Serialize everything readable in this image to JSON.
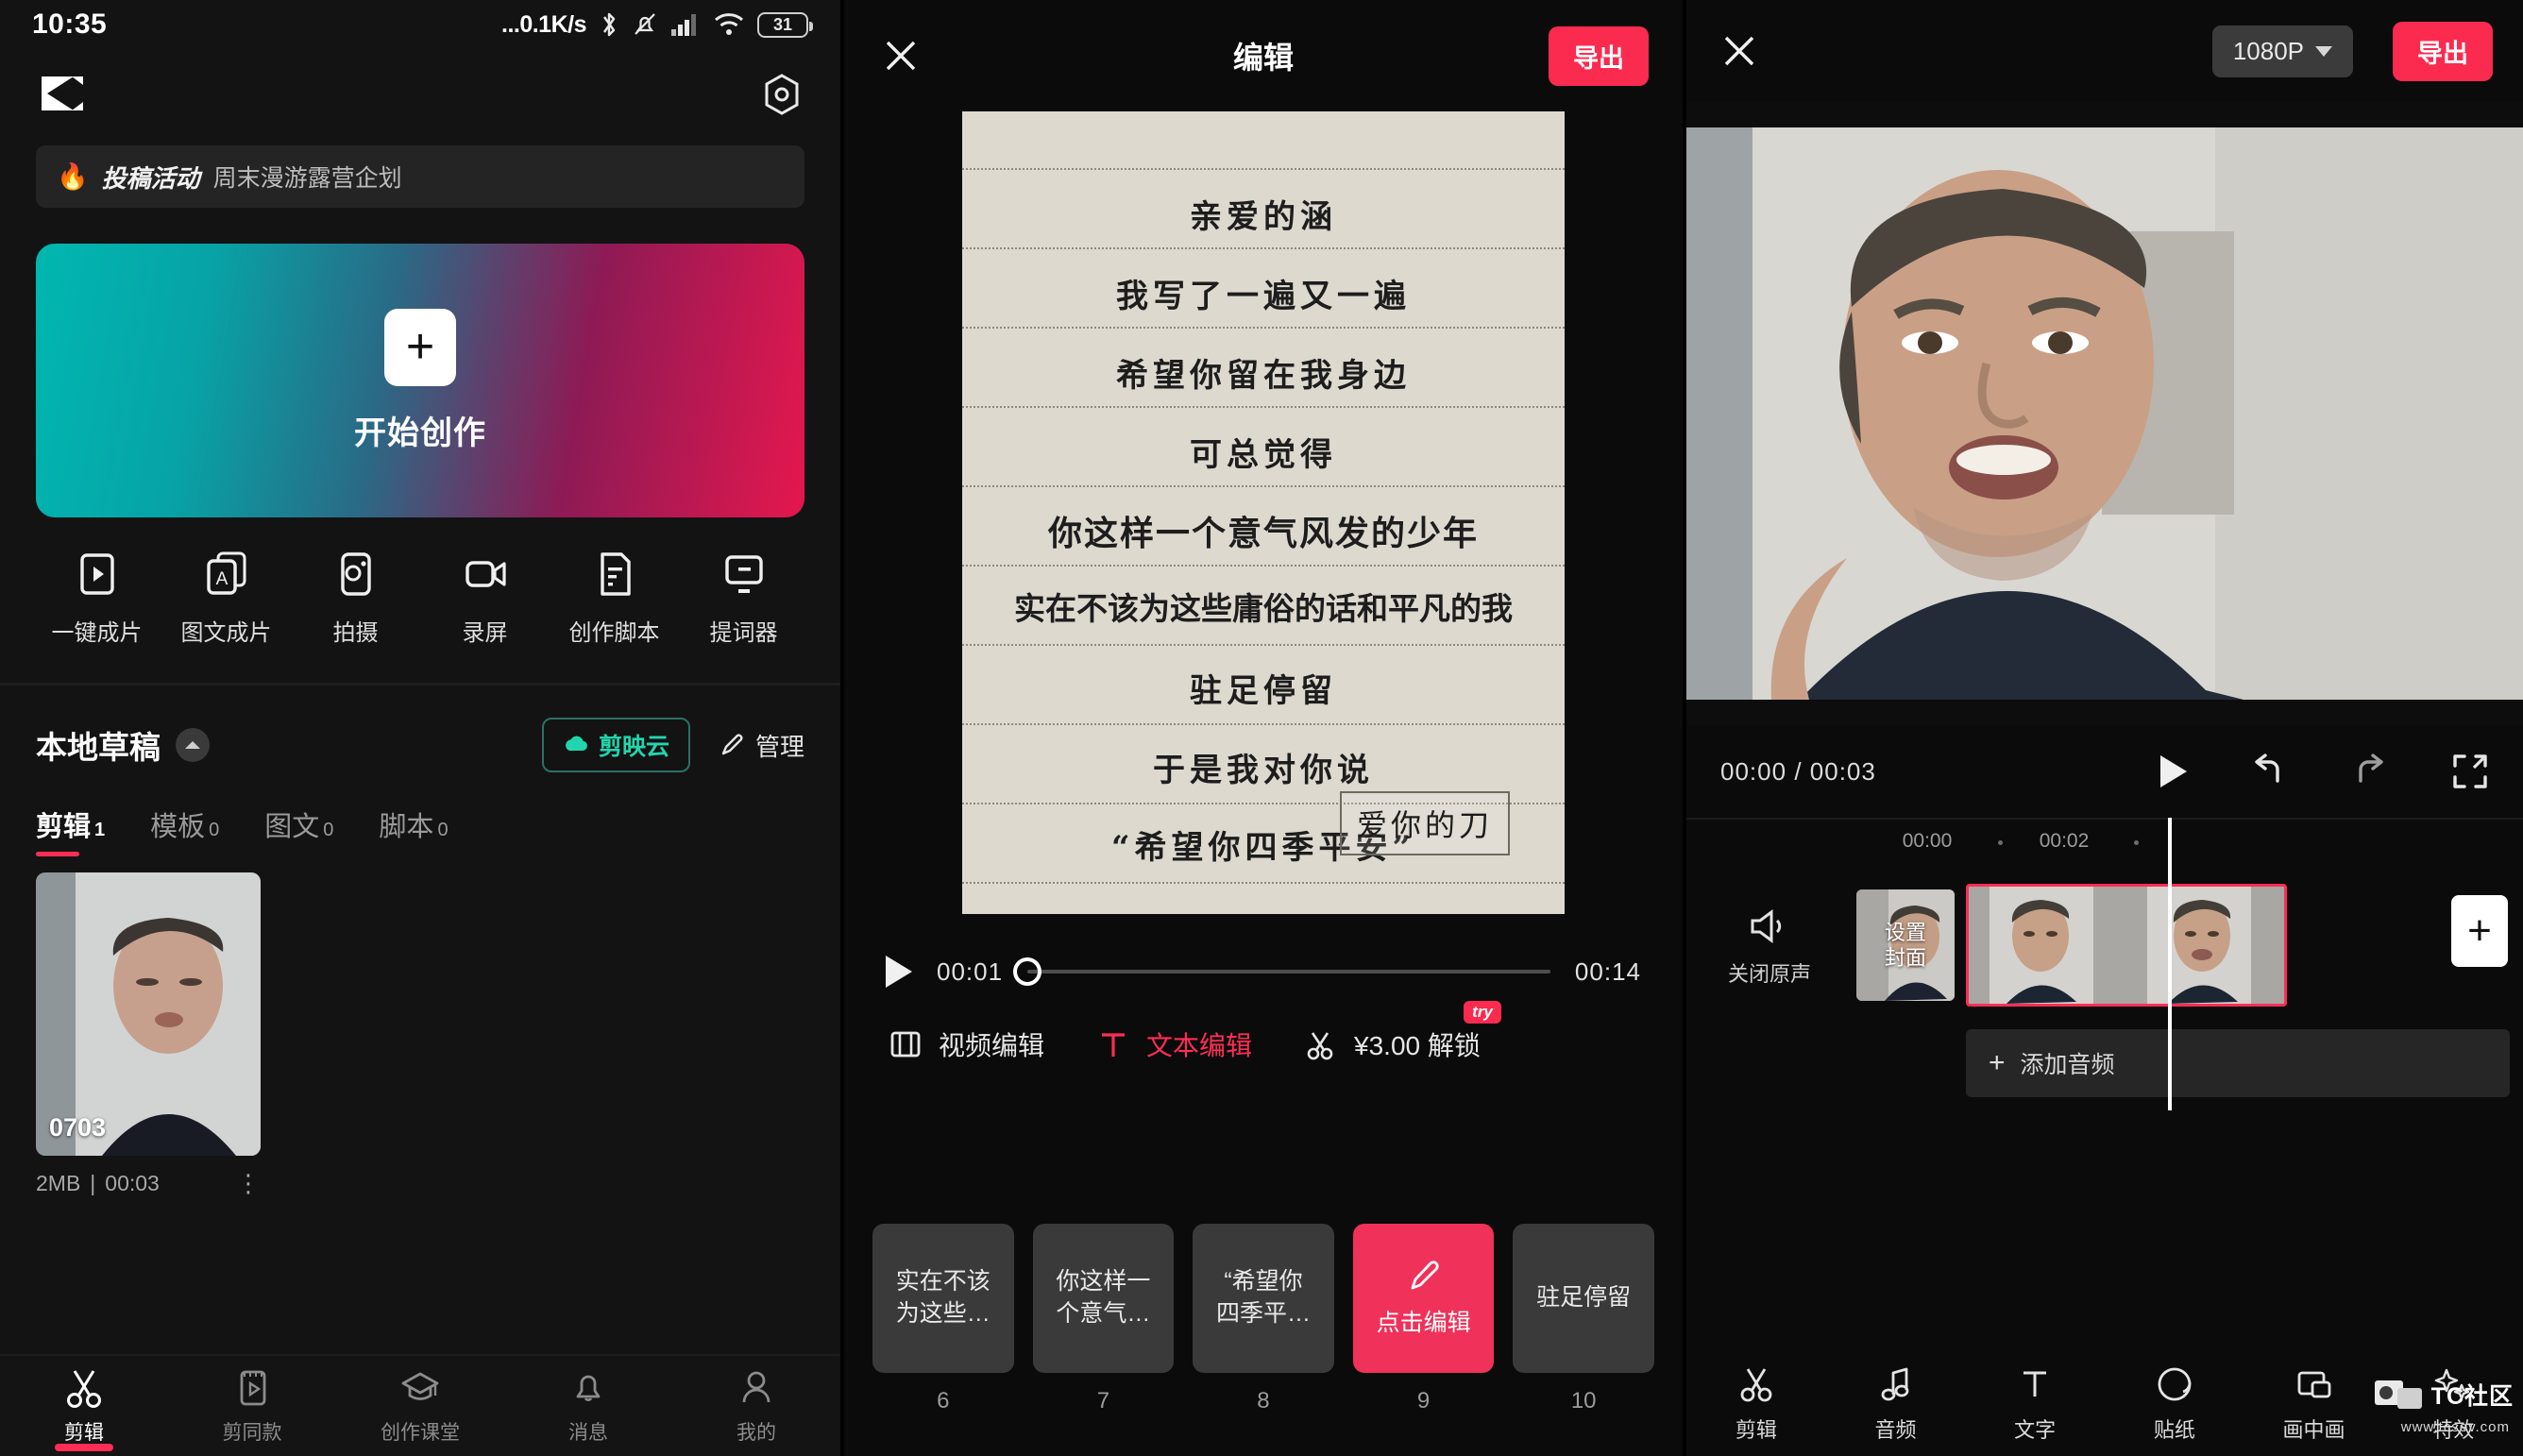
{
  "status_bar": {
    "time": "10:35",
    "net_speed": "...0.1K/s",
    "battery_level": "31",
    "icons": [
      "bluetooth-icon",
      "bell-muted-icon",
      "cell-signal-icon",
      "wifi-icon",
      "battery-icon"
    ]
  },
  "home": {
    "logo_name": "capcut-logo",
    "settings_icon": "gear-icon",
    "promo": {
      "flame": "🔥",
      "tag": "投稿活动",
      "text": "周末漫游露营企划"
    },
    "create_card": {
      "plus": "+",
      "label": "开始创作"
    },
    "quick_actions": [
      {
        "icon": "one-click-film-icon",
        "label": "一键成片"
      },
      {
        "icon": "image-text-film-icon",
        "label": "图文成片"
      },
      {
        "icon": "camera-icon",
        "label": "拍摄"
      },
      {
        "icon": "screen-record-icon",
        "label": "录屏"
      },
      {
        "icon": "script-icon",
        "label": "创作脚本"
      },
      {
        "icon": "teleprompter-icon",
        "label": "提词器"
      }
    ],
    "drafts": {
      "title": "本地草稿",
      "collapse_icon": "chevron-up-icon",
      "cloud_label": "剪映云",
      "cloud_icon": "cloud-icon",
      "manage_label": "管理",
      "manage_icon": "pencil-icon",
      "tabs": [
        {
          "label": "剪辑",
          "count": "1",
          "active": true
        },
        {
          "label": "模板",
          "count": "0",
          "active": false
        },
        {
          "label": "图文",
          "count": "0",
          "active": false
        },
        {
          "label": "脚本",
          "count": "0",
          "active": false
        }
      ],
      "items": [
        {
          "name": "0703",
          "size": "2MB",
          "sep": "|",
          "duration": "00:03",
          "more_icon": "more-vertical-icon"
        }
      ]
    },
    "tabbar": [
      {
        "icon": "scissors-icon",
        "label": "剪辑",
        "active": true
      },
      {
        "icon": "template-icon",
        "label": "剪同款",
        "active": false
      },
      {
        "icon": "graduation-cap-icon",
        "label": "创作课堂",
        "active": false
      },
      {
        "icon": "bell-icon",
        "label": "消息",
        "active": false
      },
      {
        "icon": "person-icon",
        "label": "我的",
        "active": false
      }
    ]
  },
  "editor": {
    "close_icon": "close-icon",
    "title": "编辑",
    "export_label": "导出",
    "letter_lines": [
      "亲爱的涵",
      "我写了一遍又一遍",
      "希望你留在我身边",
      "可总觉得",
      "你这样一个意气风发的少年",
      "实在不该为这些庸俗的话和平凡的我",
      "驻足停留",
      "于是我对你说",
      "“希望你四季平安”"
    ],
    "signature": "爱你的刀",
    "playback": {
      "play_icon": "play-icon",
      "current_time": "00:01",
      "total_time": "00:14"
    },
    "tools": [
      {
        "icon": "film-icon",
        "label": "视频编辑",
        "active": false
      },
      {
        "icon": "text-t-icon",
        "label": "文本编辑",
        "active": true
      },
      {
        "icon": "scissors-icon",
        "label": "¥3.00 解锁",
        "active": false,
        "badge": "try"
      }
    ],
    "chips": [
      {
        "text": "实在不该\n为这些…",
        "num": "6",
        "active": false
      },
      {
        "text": "你这样一\n个意气…",
        "num": "7",
        "active": false
      },
      {
        "text": "“希望你\n四季平…",
        "num": "8",
        "active": false
      },
      {
        "text": "点击编辑",
        "num": "9",
        "active": true,
        "icon": "pencil-icon"
      },
      {
        "text": "驻足停留",
        "num": "10",
        "active": false
      }
    ]
  },
  "timeline": {
    "close_icon": "close-icon",
    "resolution": "1080P",
    "resolution_caret": "chevron-down-icon",
    "export_label": "导出",
    "playback": {
      "current_time": "00:00",
      "separator": "/",
      "total_time": "00:03",
      "play_icon": "play-icon",
      "undo_icon": "undo-icon",
      "redo_icon": "redo-icon",
      "fullscreen_icon": "fullscreen-icon"
    },
    "ruler_labels": [
      "00:00",
      "00:02"
    ],
    "mute": {
      "icon": "speaker-icon",
      "label": "关闭原声"
    },
    "cover": {
      "label": "设置\n封面"
    },
    "audio_row": {
      "plus": "+",
      "label": "添加音频"
    },
    "add_clip": "+",
    "tabbar": [
      {
        "icon": "scissors-icon",
        "label": "剪辑"
      },
      {
        "icon": "music-note-icon",
        "label": "音频"
      },
      {
        "icon": "text-t-icon",
        "label": "文字"
      },
      {
        "icon": "sticker-icon",
        "label": "贴纸"
      },
      {
        "icon": "picture-in-picture-icon",
        "label": "画中画"
      },
      {
        "icon": "effects-icon",
        "label": "特效"
      }
    ]
  },
  "watermark": {
    "text": "TC社区",
    "sub": "www.tcsev.com"
  },
  "colors": {
    "accent_pink": "#ff2d55",
    "export_red": "#fa2b4f",
    "cloud_teal": "#21d6ae"
  }
}
